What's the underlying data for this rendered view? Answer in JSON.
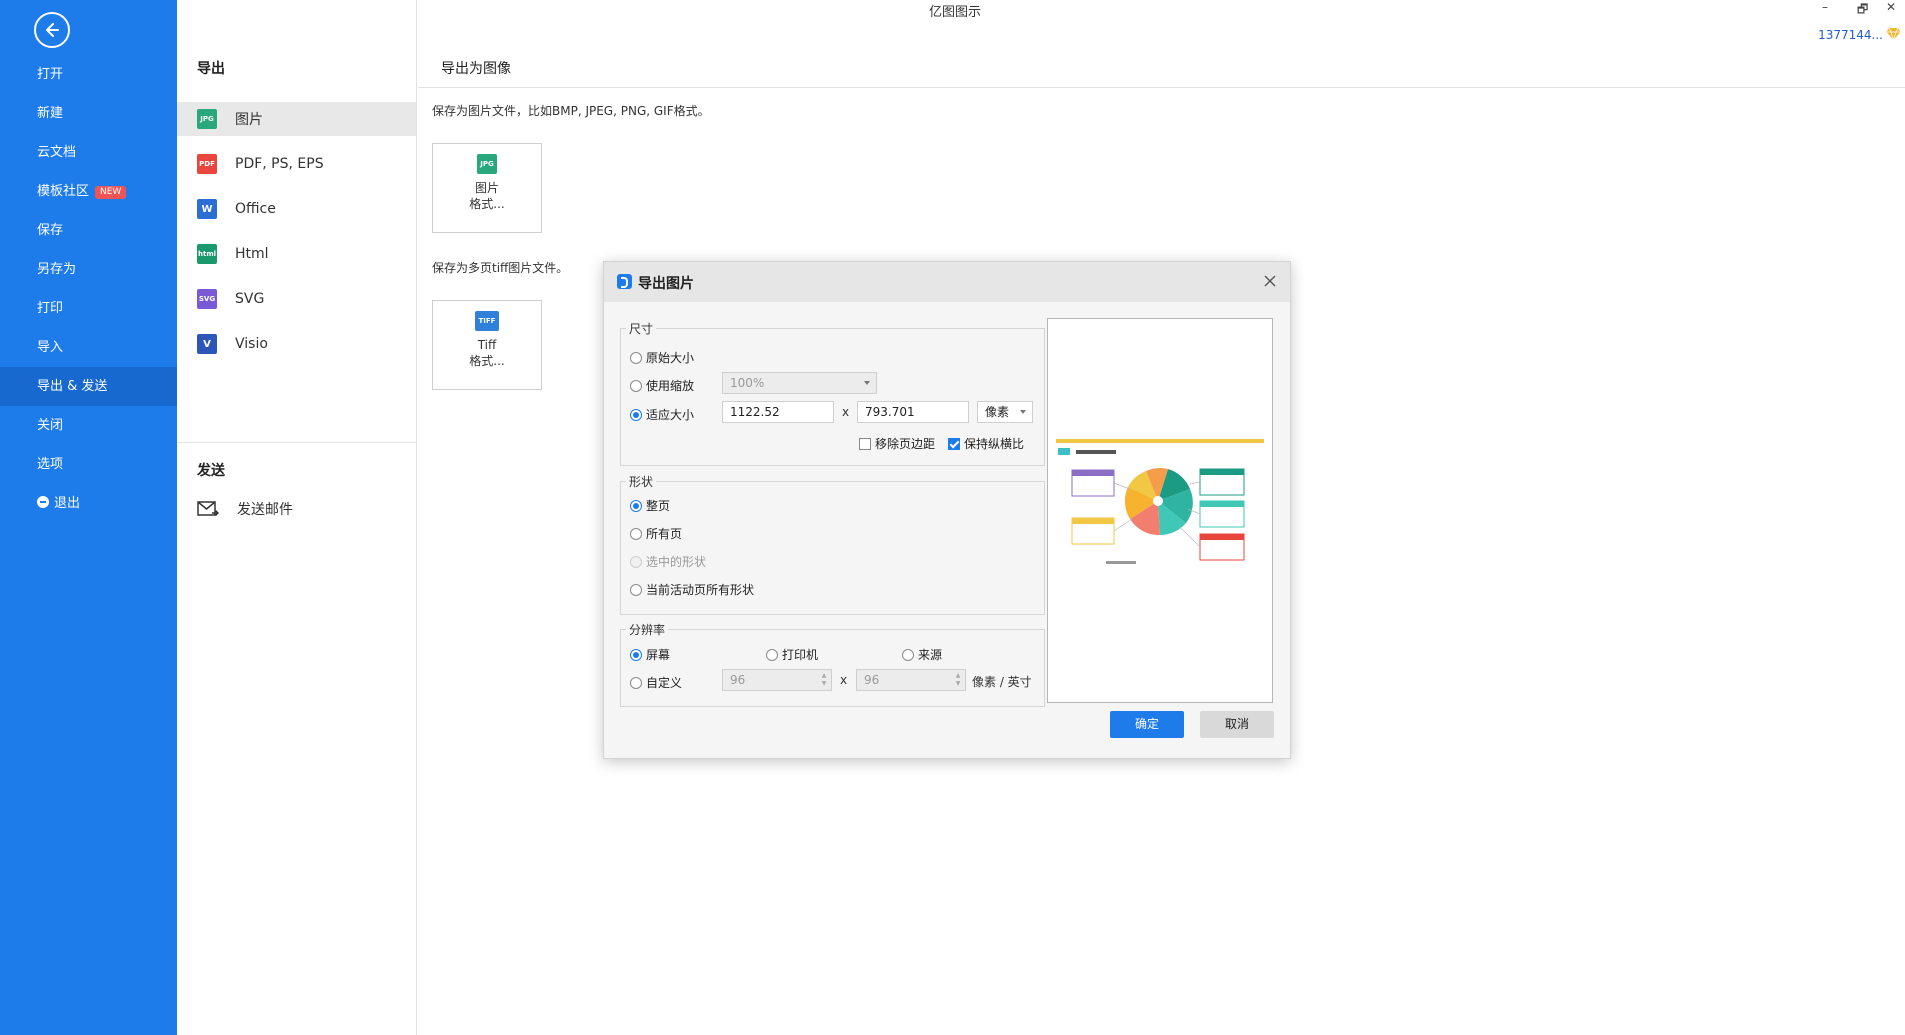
{
  "app": {
    "title": "亿图图示",
    "user_id": "1377144...",
    "minimize": "–",
    "restore": "🗗",
    "close": "✕"
  },
  "sidebar": {
    "items": [
      {
        "label": "打开"
      },
      {
        "label": "新建"
      },
      {
        "label": "云文档"
      },
      {
        "label": "模板社区",
        "badge": "NEW"
      },
      {
        "label": "保存"
      },
      {
        "label": "另存为"
      },
      {
        "label": "打印"
      },
      {
        "label": "导入"
      },
      {
        "label": "导出 & 发送"
      },
      {
        "label": "关闭"
      },
      {
        "label": "选项"
      },
      {
        "label": "退出"
      }
    ]
  },
  "export_col": {
    "title": "导出",
    "formats": [
      {
        "label": "图片",
        "icon": "JPG",
        "color": "#2aa87d"
      },
      {
        "label": "PDF, PS, EPS",
        "icon": "PDF",
        "color": "#e8463c"
      },
      {
        "label": "Office",
        "icon": "W",
        "color": "#2b6fd6"
      },
      {
        "label": "Html",
        "icon": "html",
        "color": "#1a9a6c"
      },
      {
        "label": "SVG",
        "icon": "SVG",
        "color": "#7a5ad4"
      },
      {
        "label": "Visio",
        "icon": "V",
        "color": "#2c56b8"
      }
    ],
    "send_title": "发送",
    "send_items": [
      {
        "label": "发送邮件"
      }
    ]
  },
  "content": {
    "header": "导出为图像",
    "desc1": "保存为图片文件，比如BMP, JPEG, PNG, GIF格式。",
    "card1": {
      "icon": "JPG",
      "line1": "图片",
      "line2": "格式..."
    },
    "desc2": "保存为多页tiff图片文件。",
    "card2": {
      "icon": "TIFF",
      "line1": "Tiff",
      "line2": "格式..."
    }
  },
  "dialog": {
    "title": "导出图片",
    "size": {
      "title": "尺寸",
      "original": "原始大小",
      "use_scale": "使用缩放",
      "scale_value": "100%",
      "fit": "适应大小",
      "width": "1122.52",
      "height": "793.701",
      "times": "x",
      "unit": "像素",
      "remove_margin": "移除页边距",
      "keep_ratio": "保持纵横比"
    },
    "shape": {
      "title": "形状",
      "whole_page": "整页",
      "all_pages": "所有页",
      "selected": "选中的形状",
      "current_page_shapes": "当前活动页所有形状"
    },
    "resolution": {
      "title": "分辨率",
      "screen": "屏幕",
      "printer": "打印机",
      "source": "来源",
      "custom": "自定义",
      "x_value": "96",
      "y_value": "96",
      "times": "x",
      "unit": "像素 / 英寸"
    },
    "ok": "确定",
    "cancel": "取消"
  }
}
